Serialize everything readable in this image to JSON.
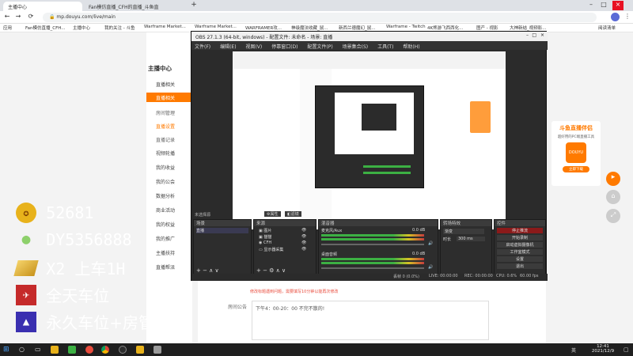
{
  "browser": {
    "tabs": [
      {
        "label": "主播中心",
        "active": true
      },
      {
        "label": "Fan模仿直播_CFH的直播_斗鱼直",
        "active": false
      }
    ],
    "new_tab": "+",
    "url": "mp.douyu.com/live/main",
    "bookmarks": [
      "应用",
      "Fan模仿直播_CFH...",
      "主播中心",
      "我的关注 - 斗鱼",
      "Warframe Market...",
      "Warframe Market...",
      "WARFRAMER攻...",
      "神级魔法收藏_鼠...",
      "新西兰德魔幻_鼠...",
      "Warframe - Twitch",
      "4K熊游飞西西化...",
      "图产 - 视影",
      "大神新结_视频影...",
      "阅读清单"
    ]
  },
  "douyu_site": {
    "logo": "斗鱼",
    "sidebar_title": "主播中心",
    "sidebar_items": [
      "直播相关",
      "直播相关",
      "房间管理",
      "直播设置",
      "直播记录",
      "视频轮播",
      "我的收益",
      "我的公会",
      "数据分析",
      "商业活动",
      "我的权益",
      "我的推广",
      "主播扶持",
      "直播帮派"
    ],
    "announcement_label": "房间公告",
    "announcement_text": "下午4：00-20：00 不完不散的!",
    "notice_links": "修改标题遇到问题，需要填写10分钟以能再次修改",
    "promo_title": "斗鱼直播伴侣",
    "promo_sub": "超好用的PC端直播工具",
    "promo_button": "立即下载",
    "promo_logo": "DOUYU"
  },
  "obs": {
    "title": "OBS 27.1.3 (64-bit, windows) - 配置文件: 未命名 - 场景: 直播",
    "menu": [
      "文件(F)",
      "编辑(E)",
      "视图(V)",
      "停靠窗口(D)",
      "配置文件(P)",
      "场景集合(S)",
      "工具(T)",
      "帮助(H)"
    ],
    "inactive_label": "未选择源",
    "props_button": "属性",
    "filters_button": "滤镜",
    "docks": {
      "scenes": {
        "title": "场景",
        "items": [
          "直播"
        ]
      },
      "sources": {
        "title": "来源",
        "items": [
          "图片",
          "猫猫",
          "CFH",
          "显示器采集"
        ]
      },
      "mixer": {
        "title": "混音器",
        "tracks": [
          {
            "name": "桌面音频",
            "level": "0.0 dB"
          },
          {
            "name": "麦克风/Aux",
            "level": "0.0 dB"
          }
        ]
      },
      "transitions": {
        "title": "转场特效",
        "type": "渐变",
        "duration_label": "时长",
        "duration": "300 ms"
      },
      "controls": {
        "title": "控件",
        "buttons": [
          "停止推流",
          "开始录制",
          "启动虚拟摄像机",
          "工作室模式",
          "设置",
          "退出"
        ]
      }
    },
    "status": {
      "dropped": "丢帧 0 (0.0%)",
      "live": "LIVE: 00:00:00",
      "rec": "REC: 00:00:00",
      "cpu": "CPU: 0.6%",
      "fps": "60.00 fps"
    }
  },
  "overlay": {
    "items": [
      {
        "icon": "gold-rocket-icon",
        "text": "52681"
      },
      {
        "icon": "wechat-icon",
        "text": "DY5356888"
      },
      {
        "icon": "gold-bar-icon",
        "text": "X2 上车1H"
      },
      {
        "icon": "plane-card-icon",
        "text": "全天车位"
      },
      {
        "icon": "rocket-card-icon",
        "text": "永久车位+房管"
      }
    ]
  },
  "taskbar": {
    "time": "12:41",
    "date": "2021/12/9",
    "lang": "英"
  },
  "colors": {
    "douyu_orange": "#ff7a00",
    "overlay_text": "#ffffff",
    "obs_bg": "#2b2b2b",
    "obs_red_button": "#8b1a1a"
  }
}
